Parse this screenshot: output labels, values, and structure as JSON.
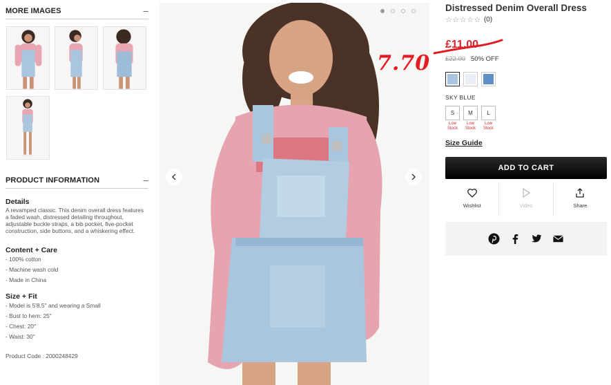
{
  "more_images": {
    "title": "MORE IMAGES",
    "toggle": "–"
  },
  "product_information": {
    "title": "PRODUCT INFORMATION",
    "toggle": "–",
    "details_heading": "Details",
    "details_text": "A revamped classic. This denim overall dress features a faded wash, distressed detailing throughout, adjustable buckle straps, a bib pocket, five-pocket construction, side buttons, and a whiskering effect.",
    "content_heading": "Content + Care",
    "content_items": [
      "- 100% cotton",
      "- Machine wash cold",
      "- Made in China"
    ],
    "size_heading": "Size + Fit",
    "size_items": [
      "- Model is 5'8.5\" and wearing a Small",
      "- Bust to hem: 25\"",
      "- Chest: 20\"",
      "- Waist: 30\""
    ],
    "product_code": "Product Code : 2000248429"
  },
  "product": {
    "name": "Distressed Denim Overall Dress",
    "stars": "☆☆☆☆☆",
    "review_count": "(0)",
    "sale_price": "£11.00",
    "original_price": "£22.00",
    "discount": "50% OFF",
    "annotation_price": "7.70",
    "color_name": "SKY BLUE",
    "swatch_colors": [
      "#a9c4de",
      "#e8eef4",
      "#5f8fc4"
    ],
    "sizes": [
      {
        "label": "S",
        "stock": "Low Stock"
      },
      {
        "label": "M",
        "stock": "Low Stock"
      },
      {
        "label": "L",
        "stock": "Low Stock"
      }
    ],
    "size_guide": "Size Guide",
    "add_to_cart": "ADD TO CART"
  },
  "actions": [
    {
      "label": "Wishlist",
      "icon": "heart-icon"
    },
    {
      "label": "Video",
      "icon": "play-icon"
    },
    {
      "label": "Share",
      "icon": "share-icon"
    }
  ],
  "social_icons": [
    "pinterest-icon",
    "facebook-icon",
    "twitter-icon",
    "email-icon"
  ],
  "carousel": {
    "dot_count": 4,
    "active_index": 0
  }
}
